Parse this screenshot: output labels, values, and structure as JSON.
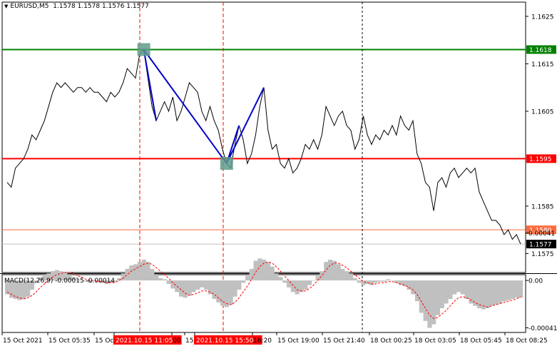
{
  "header": {
    "symbol": "EURUSD,M5",
    "ohlc": "1.1578 1.1578 1.1576 1.1577"
  },
  "macd_header": {
    "name": "MACD(12,26,9)",
    "values": "-0.00015 -0.00014"
  },
  "colors": {
    "background": "#ffffff",
    "price_line": "#000000",
    "green_level": "#008000",
    "red_level": "#ff0000",
    "orange_level": "#ff6a3d",
    "trend_line": "#0000c8",
    "marker": "#5f9a8c",
    "macd_hist": "#c0c0c0",
    "macd_signal": "#ff0000",
    "grid_vline": "#000000",
    "time_highlight_bg": "#ff0000",
    "current_price_bg": "#000000"
  },
  "chart_data": [
    {
      "type": "line",
      "title": "EURUSD,M5",
      "xlabel": "",
      "ylabel": "",
      "ylim": [
        1.1571,
        1.1628
      ],
      "y_ticks": [
        "1.1625",
        "1.1615",
        "1.1605",
        "1.1585",
        "1.1575"
      ],
      "y_tick_values": [
        1.1625,
        1.1615,
        1.1605,
        1.1585,
        1.1575
      ],
      "x_ticks": [
        "15 Oct 2021",
        "15 Oct 05:35",
        "15 Oct",
        "2021.10.15 11:05",
        "00",
        "15",
        "2021.10.15 15:50",
        "16:20",
        "15 Oct 19:00",
        "15 Oct 21:40",
        "18 Oct 00:25",
        "18 Oct 03:05",
        "18 Oct 05:45",
        "18 Oct 08:25"
      ],
      "highlighted_times": [
        "2021.10.15 11:05",
        "2021.10.15 15:50"
      ],
      "price_levels": [
        {
          "label": "1.1618",
          "value": 1.1618,
          "style": "green"
        },
        {
          "label": "1.1595",
          "value": 1.1595,
          "style": "red"
        },
        {
          "label": "1.1580",
          "value": 1.158,
          "style": "orange"
        },
        {
          "label": "1.1577",
          "value": 1.1577,
          "style": "current"
        }
      ],
      "series": [
        {
          "x": [
            0,
            1,
            2,
            3,
            4,
            5,
            6,
            7,
            8,
            9,
            10,
            11,
            12,
            13,
            14,
            15,
            16,
            17,
            18,
            19,
            20,
            21,
            22,
            23,
            24,
            25,
            26,
            27,
            28,
            29,
            30,
            31,
            32,
            33,
            34,
            35,
            36,
            37,
            38,
            39,
            40,
            41,
            42,
            43,
            44,
            45,
            46,
            47,
            48,
            49,
            50,
            51,
            52,
            53,
            54,
            55,
            56,
            57,
            58,
            59,
            60,
            61,
            62,
            63,
            64,
            65,
            66,
            67,
            68,
            69,
            70,
            71,
            72,
            73,
            74,
            75,
            76,
            77,
            78,
            79,
            80,
            81,
            82,
            83,
            84,
            85,
            86,
            87,
            88,
            89,
            90,
            91,
            92,
            93,
            94,
            95,
            96,
            97,
            98,
            99,
            100,
            101,
            102,
            103,
            104,
            105,
            106,
            107,
            108,
            109,
            110,
            111,
            112,
            113,
            114,
            115,
            116,
            117,
            118,
            119,
            120,
            121,
            122,
            123,
            124
          ],
          "values": [
            1.159,
            1.1589,
            1.1593,
            1.1594,
            1.1595,
            1.1597,
            1.16,
            1.1599,
            1.1601,
            1.1603,
            1.1606,
            1.1609,
            1.1611,
            1.161,
            1.1611,
            1.161,
            1.1609,
            1.161,
            1.161,
            1.1609,
            1.161,
            1.1609,
            1.1609,
            1.1608,
            1.1607,
            1.1609,
            1.1608,
            1.1609,
            1.1611,
            1.1614,
            1.1613,
            1.1612,
            1.1617,
            1.1618,
            1.1612,
            1.1606,
            1.1603,
            1.1605,
            1.1607,
            1.1605,
            1.1608,
            1.1603,
            1.1605,
            1.1608,
            1.1611,
            1.161,
            1.1609,
            1.1605,
            1.1603,
            1.1606,
            1.1603,
            1.1601,
            1.1597,
            1.1594,
            1.1593,
            1.1598,
            1.1602,
            1.1599,
            1.1594,
            1.1596,
            1.16,
            1.1606,
            1.161,
            1.1601,
            1.1597,
            1.1598,
            1.1594,
            1.1593,
            1.1595,
            1.1592,
            1.1593,
            1.1595,
            1.1598,
            1.1597,
            1.1599,
            1.1597,
            1.16,
            1.1606,
            1.1604,
            1.1602,
            1.1604,
            1.1605,
            1.1602,
            1.1601,
            1.1597,
            1.1599,
            1.1604,
            1.16,
            1.1598,
            1.16,
            1.1599,
            1.1601,
            1.16,
            1.1602,
            1.16,
            1.1604,
            1.1602,
            1.1601,
            1.1603,
            1.1596,
            1.1594,
            1.159,
            1.1589,
            1.1584,
            1.159,
            1.1591,
            1.1589,
            1.1592,
            1.1593,
            1.1591,
            1.1592,
            1.1593,
            1.1592,
            1.1593,
            1.1588,
            1.1586,
            1.1584,
            1.1582,
            1.1582,
            1.1581,
            1.1579,
            1.158,
            1.1578,
            1.1579,
            1.1577
          ]
        }
      ],
      "trend_lines": [
        {
          "from": [
            33,
            1.1618
          ],
          "to": [
            36,
            1.1603
          ]
        },
        {
          "from": [
            33,
            1.1618
          ],
          "to": [
            53,
            1.1594
          ]
        },
        {
          "from": [
            53,
            1.1594
          ],
          "to": [
            56,
            1.1602
          ]
        },
        {
          "from": [
            53,
            1.1594
          ],
          "to": [
            62,
            1.161
          ]
        }
      ],
      "markers": [
        {
          "x": 33,
          "y": 1.1618
        },
        {
          "x": 53,
          "y": 1.1594
        }
      ]
    },
    {
      "type": "bar",
      "title": "MACD(12,26,9)",
      "ylim": [
        -0.00045,
        5e-05
      ],
      "y_ticks": [
        "0.00041",
        "0.00",
        "-0.00041"
      ],
      "y_tick_values": [
        0.00041,
        0.0,
        -0.00041
      ],
      "series": [
        {
          "name": "",
          "values": [
            -0.00012,
            -0.00015,
            -0.00016,
            -0.00017,
            -0.00016,
            -0.00014,
            -8e-05,
            -2e-05,
            3e-05,
            5e-05,
            6e-05,
            8e-05,
            9e-05,
            8e-05,
            7e-05,
            5e-05,
            3e-05,
            1e-05,
            0.0,
            -1e-05,
            -2e-05,
            0.0,
            -1e-05,
            -2e-05,
            -3e-05,
            -2e-05,
            -1e-05,
            2e-05,
            6e-05,
            0.0001,
            0.00013,
            0.00014,
            0.00016,
            0.00018,
            0.00016,
            0.0001,
            5e-05,
            2e-05,
            1e-05,
            -3e-05,
            -7e-05,
            -0.0001,
            -0.00014,
            -0.00015,
            -0.00013,
            -0.0001,
            -8e-05,
            -6e-05,
            -8e-05,
            -0.00012,
            -0.00016,
            -0.00019,
            -0.00022,
            -0.00023,
            -0.00021,
            -0.00014,
            -8e-05,
            -2e-05,
            4e-05,
            0.0001,
            0.00017,
            0.00019,
            0.00018,
            0.00016,
            0.00012,
            6e-05,
            3e-05,
            -2e-05,
            -6e-05,
            -0.0001,
            -0.00012,
            -0.0001,
            -8e-05,
            -4e-05,
            0.0,
            4e-05,
            8e-05,
            0.00016,
            0.00018,
            0.00017,
            0.00014,
            0.0001,
            8e-05,
            6e-05,
            2e-05,
            -2e-05,
            -4e-05,
            -3e-05,
            -4e-05,
            -2e-05,
            -1e-05,
            -1e-05,
            1e-05,
            0.0,
            -2e-05,
            -4e-05,
            -5e-05,
            -8e-05,
            -0.00012,
            -0.00018,
            -0.00028,
            -0.00035,
            -0.00041,
            -0.00038,
            -0.0003,
            -0.00024,
            -0.0002,
            -0.00016,
            -0.00012,
            -0.0001,
            -0.00012,
            -0.00016,
            -0.0002,
            -0.00022,
            -0.00024,
            -0.00025,
            -0.00024,
            -0.00022,
            -0.00021,
            -0.0002,
            -0.00018,
            -0.00017,
            -0.00016,
            -0.00015,
            -0.00015
          ]
        },
        {
          "name": "",
          "values": [
            -0.0001,
            -0.00012,
            -0.00014,
            -0.00015,
            -0.00016,
            -0.00015,
            -0.00013,
            -0.0001,
            -6e-05,
            -3e-05,
            0.0,
            3e-05,
            5e-05,
            6e-05,
            7e-05,
            7e-05,
            6e-05,
            4e-05,
            3e-05,
            1e-05,
            0.0,
            0.0,
            -1e-05,
            -1e-05,
            -2e-05,
            -2e-05,
            -2e-05,
            0.0,
            2e-05,
            5e-05,
            8e-05,
            0.0001,
            0.00012,
            0.00014,
            0.00015,
            0.00014,
            0.00011,
            8e-05,
            5e-05,
            2e-05,
            -2e-05,
            -5e-05,
            -8e-05,
            -0.00011,
            -0.00013,
            -0.00012,
            -0.00011,
            -9e-05,
            -9e-05,
            -0.0001,
            -0.00012,
            -0.00015,
            -0.00018,
            -0.0002,
            -0.00021,
            -0.00019,
            -0.00015,
            -0.0001,
            -5e-05,
            1e-05,
            7e-05,
            0.00012,
            0.00015,
            0.00016,
            0.00015,
            0.00012,
            8e-05,
            4e-05,
            0.0,
            -4e-05,
            -8e-05,
            -9e-05,
            -9e-05,
            -7e-05,
            -4e-05,
            0.0,
            4e-05,
            9e-05,
            0.00013,
            0.00015,
            0.00015,
            0.00013,
            0.00011,
            8e-05,
            5e-05,
            2e-05,
            -1e-05,
            -2e-05,
            -3e-05,
            -3e-05,
            -2e-05,
            -2e-05,
            -1e-05,
            -1e-05,
            -2e-05,
            -3e-05,
            -4e-05,
            -6e-05,
            -8e-05,
            -0.00012,
            -0.00018,
            -0.00024,
            -0.0003,
            -0.00033,
            -0.00032,
            -0.00029,
            -0.00026,
            -0.00022,
            -0.00018,
            -0.00015,
            -0.00014,
            -0.00015,
            -0.00017,
            -0.00019,
            -0.00021,
            -0.00022,
            -0.00023,
            -0.00022,
            -0.00021,
            -0.0002,
            -0.00019,
            -0.00018,
            -0.00017,
            -0.00016,
            -0.00014
          ]
        }
      ]
    }
  ]
}
